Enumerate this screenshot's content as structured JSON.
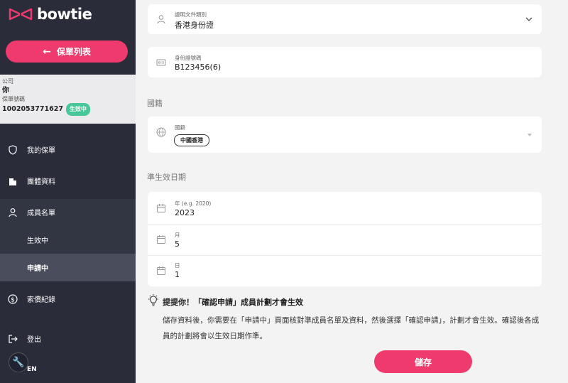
{
  "brand": {
    "name": "bowtie",
    "accent": "#ee3a6c"
  },
  "sidebar": {
    "back_label": "保單列表",
    "policy": {
      "company_label": "公司",
      "company_value": "你",
      "policy_no_label": "保單號碼",
      "policy_no": "1002053771627",
      "status": "生效中"
    },
    "nav": {
      "my_policy": "我的保單",
      "group_info": "團體資料",
      "members": "成員名單",
      "active": "生效中",
      "applying": "申請中",
      "claims": "索償紀錄",
      "logout": "登出"
    },
    "language": "EN"
  },
  "form": {
    "doc_type": {
      "label": "證明文件類別",
      "value": "香港身份證"
    },
    "id_number": {
      "label": "身份證號碼",
      "value": "B123456(6)"
    },
    "nationality_section": "國籍",
    "nationality": {
      "label": "國籍",
      "value": "中國香港"
    },
    "effective_section": "準生效日期",
    "year": {
      "label": "年",
      "hint": "(e.g. 2020)",
      "value": "2023"
    },
    "month": {
      "label": "月",
      "value": "5"
    },
    "day": {
      "label": "日",
      "value": "1"
    }
  },
  "tip": {
    "title": "提提你！「確認申請」成員計劃才會生效",
    "text": "儲存資料後，你需要在「申請中」頁面核對準成員名單及資料，然後選擇「確認申請」，計劃才會生效。確認後各成員的計劃將會以生效日期作準。"
  },
  "save_label": "儲存"
}
